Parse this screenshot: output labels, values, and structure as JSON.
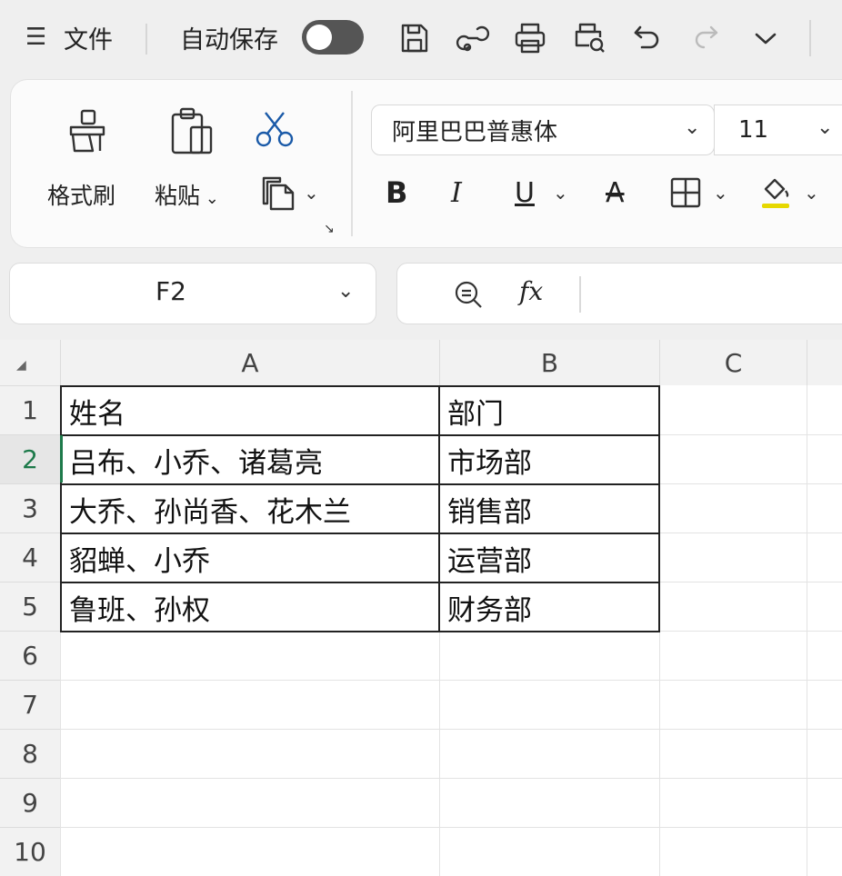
{
  "titlebar": {
    "menu_icon": "hamburger-icon",
    "menu_label": "文件",
    "autosave_label": "自动保存",
    "autosave_on": false,
    "quick_access_icons": [
      "save-icon",
      "sync-icon",
      "print-icon",
      "print-preview-icon",
      "undo-icon",
      "redo-icon",
      "chevron-down-icon"
    ]
  },
  "ribbon": {
    "format_painter_label": "格式刷",
    "paste_label": "粘贴",
    "font_name": "阿里巴巴普惠体",
    "font_size": "11",
    "bold_glyph": "B",
    "italic_glyph": "I",
    "underline_glyph": "U",
    "strike_glyph": "A",
    "highlight_color": "#e6d800"
  },
  "formula_bar": {
    "name_box": "F2",
    "fx_label": "fx",
    "formula": ""
  },
  "sheet": {
    "columns": [
      "A",
      "B",
      "C"
    ],
    "rows": [
      "1",
      "2",
      "3",
      "4",
      "5",
      "6",
      "7",
      "8",
      "9",
      "10"
    ],
    "active_row": "2",
    "cells": [
      [
        "姓名",
        "部门"
      ],
      [
        "吕布、小乔、诸葛亮",
        "市场部"
      ],
      [
        "大乔、孙尚香、花木兰",
        "销售部"
      ],
      [
        "貂蝉、小乔",
        "运营部"
      ],
      [
        "鲁班、孙权",
        "财务部"
      ]
    ]
  },
  "colors": {
    "accent_green": "#1d7a4a",
    "background": "#efefef"
  }
}
